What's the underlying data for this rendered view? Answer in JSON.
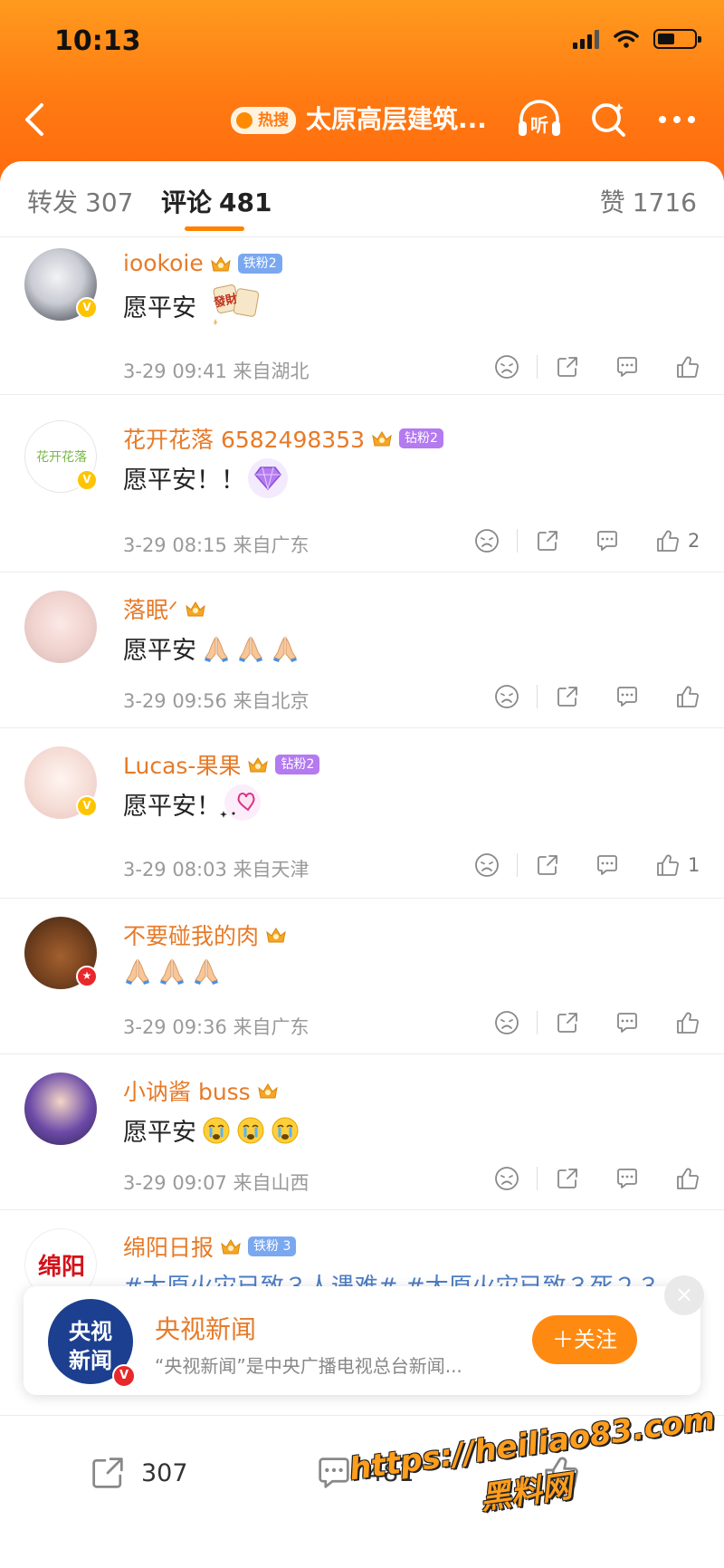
{
  "status_bar": {
    "time": "10:13"
  },
  "nav": {
    "hot_badge": "热搜",
    "title": "太原高层建筑...",
    "listen_label": "听"
  },
  "tabs": {
    "repost_label": "转发",
    "repost_count": "307",
    "comment_label": "评论",
    "comment_count": "481",
    "like_label": "赞",
    "like_count": "1716"
  },
  "comments": [
    {
      "user": "iookoie",
      "badge": "铁粉2",
      "text": "愿平安",
      "sticker": "發財",
      "time": "3-29 09:41",
      "location": "来自湖北",
      "likes": ""
    },
    {
      "user": "花开花落 6582498353",
      "badge": "钻粉2",
      "text": "愿平安！！",
      "avatar_text": "花开花落",
      "time": "3-29 08:15",
      "location": "来自广东",
      "likes": "2"
    },
    {
      "user": "落眠ᐟ",
      "badge": "",
      "text": "愿平安",
      "time": "3-29 09:56",
      "location": "来自北京",
      "likes": ""
    },
    {
      "user": "Lucas-果果",
      "badge": "钻粉2",
      "text": "愿平安！",
      "time": "3-29 08:03",
      "location": "来自天津",
      "likes": "1"
    },
    {
      "user": "不要碰我的肉",
      "badge": "",
      "text": "",
      "time": "3-29 09:36",
      "location": "来自广东",
      "likes": ""
    },
    {
      "user": "小讷酱 buss",
      "badge": "",
      "text": "愿平安",
      "time": "3-29 09:07",
      "location": "来自山西",
      "likes": ""
    },
    {
      "user": "绵阳日报",
      "badge": "铁粉 3",
      "text": "#太原火灾已致３人遇难# #太原火灾已致３死２３",
      "avatar_text": "绵阳"
    }
  ],
  "follow_card": {
    "logo_line1": "央视",
    "logo_line2": "新闻",
    "name": "央视新闻",
    "description": "“央视新闻”是中央广播电视总台新闻...",
    "follow_label": "＋关注",
    "close_glyph": "×"
  },
  "bottom_bar": {
    "repost_count": "307",
    "comment_count": "481"
  },
  "watermark": {
    "line1": "https://heiliao83.com",
    "line2": "黑料网"
  },
  "colors": {
    "brand_orange": "#ff8200",
    "username": "#e77a27",
    "header_top": "#ff9a1e",
    "header_bottom": "#ff6a0e"
  }
}
